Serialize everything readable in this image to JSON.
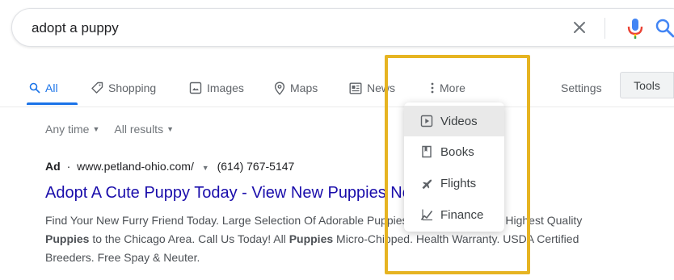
{
  "search": {
    "query": "adopt a puppy"
  },
  "tabs": [
    {
      "label": "All",
      "icon": "search-icon",
      "active": true
    },
    {
      "label": "Shopping",
      "icon": "tag-icon"
    },
    {
      "label": "Images",
      "icon": "image-icon"
    },
    {
      "label": "Maps",
      "icon": "map-pin-icon"
    },
    {
      "label": "News",
      "icon": "news-icon"
    },
    {
      "label": "More",
      "icon": "more-vert-icon"
    }
  ],
  "toolbar": {
    "settings_label": "Settings",
    "tools_label": "Tools"
  },
  "filters": {
    "time_label": "Any time",
    "results_label": "All results"
  },
  "more_menu": {
    "items": [
      {
        "label": "Videos",
        "icon": "video-icon"
      },
      {
        "label": "Books",
        "icon": "book-icon"
      },
      {
        "label": "Flights",
        "icon": "flight-icon"
      },
      {
        "label": "Finance",
        "icon": "finance-icon"
      }
    ]
  },
  "ad": {
    "badge": "Ad",
    "separator": "·",
    "url": "www.petland-ohio.com/",
    "phone": "(614) 767-5147",
    "title": "Adopt A Cute Puppy Today - View New Puppies Now",
    "description": {
      "p1": "Find Your New Furry Friend Today. Large Selection Of Adorable Puppies Now! Offering The Highest Quality ",
      "b1": "Puppies",
      "p2": " to the Chicago Area. Call Us Today! All ",
      "b2": "Puppies",
      "p3": " Micro-Chipped. Health Warranty. USDA Certified Breeders. Free Spay & Neuter."
    }
  },
  "colors": {
    "accent": "#1a73e8",
    "link": "#1a0dab",
    "highlight": "#e6b422"
  }
}
